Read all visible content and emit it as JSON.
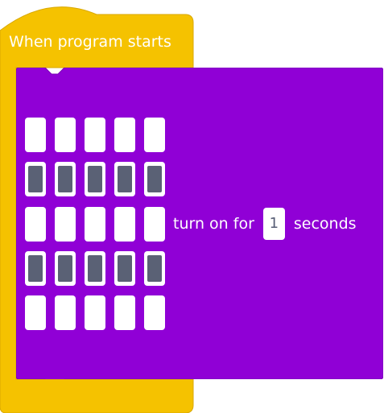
{
  "hat_block": {
    "label": "When program starts",
    "color": "#f5c200"
  },
  "display_block": {
    "color": "#9000d6",
    "led_off_color": "#ffffff",
    "led_on_color": "#5a6175",
    "leds": [
      [
        0,
        0,
        0,
        0,
        0
      ],
      [
        1,
        1,
        1,
        1,
        1
      ],
      [
        0,
        0,
        0,
        0,
        0
      ],
      [
        1,
        1,
        1,
        1,
        1
      ],
      [
        0,
        0,
        0,
        0,
        0
      ]
    ],
    "text_before": "turn on for",
    "duration_value": "1",
    "text_after": "seconds"
  }
}
